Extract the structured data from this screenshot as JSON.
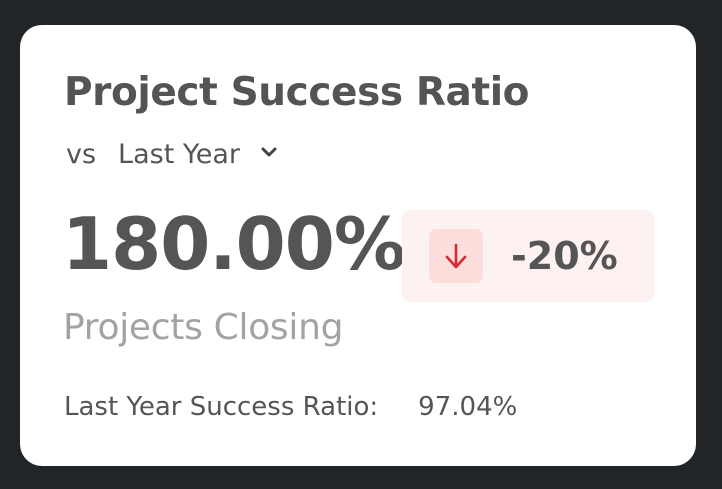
{
  "card": {
    "title": "Project Success Ratio",
    "compare_prefix": "vs",
    "compare_selected": "Last Year",
    "main_value": "180.00%",
    "change": {
      "value": "-20%",
      "direction": "down",
      "icon": "arrow-down-icon",
      "color": "#d9282f",
      "badge_bg": "#fdf2f1"
    },
    "subtitle": "Projects Closing",
    "footer_label": "Last Year Success Ratio:",
    "footer_value": "97.04%"
  },
  "colors": {
    "page_background": "#212528",
    "card_background": "#ffffff",
    "text_primary": "#555555",
    "text_muted": "#a3a3a3"
  }
}
